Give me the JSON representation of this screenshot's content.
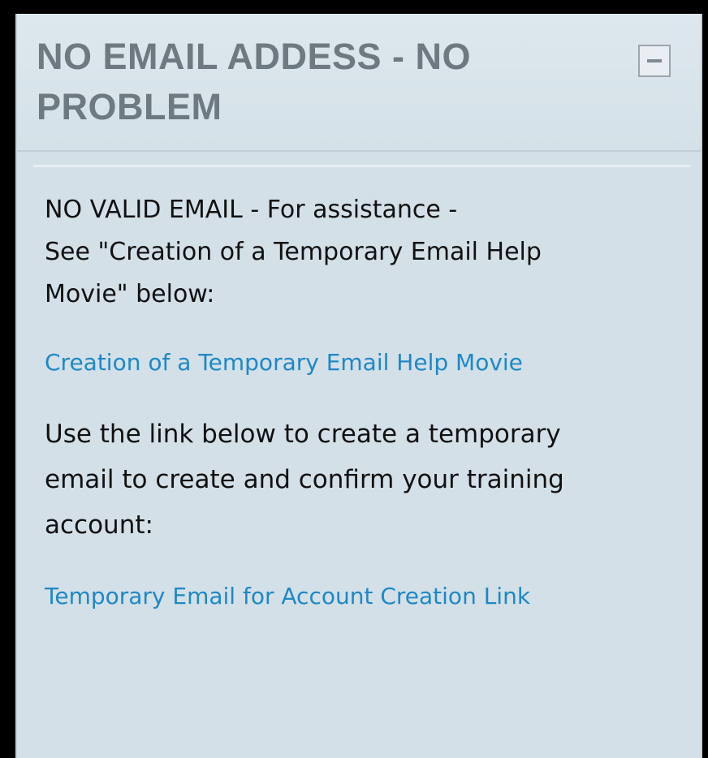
{
  "block": {
    "title": "NO EMAIL ADDESS - NO PROBLEM",
    "collapse_icon": "minus-box-icon",
    "intro_lines": [
      "NO VALID EMAIL - For assistance -",
      "See \"Creation of a Temporary Email Help",
      "Movie\" below:"
    ],
    "help_movie_link": "Creation of a Temporary Email Help Movie",
    "instruction_lines": [
      "Use the link below to create a temporary",
      "email to create and confirm your training",
      "account:"
    ],
    "temp_email_link": "Temporary Email for Account Creation Link"
  },
  "colors": {
    "background": "#000000",
    "panel": "#d3e0e8",
    "title": "#6e7a82",
    "link": "#1e88c5",
    "text": "#111111"
  }
}
